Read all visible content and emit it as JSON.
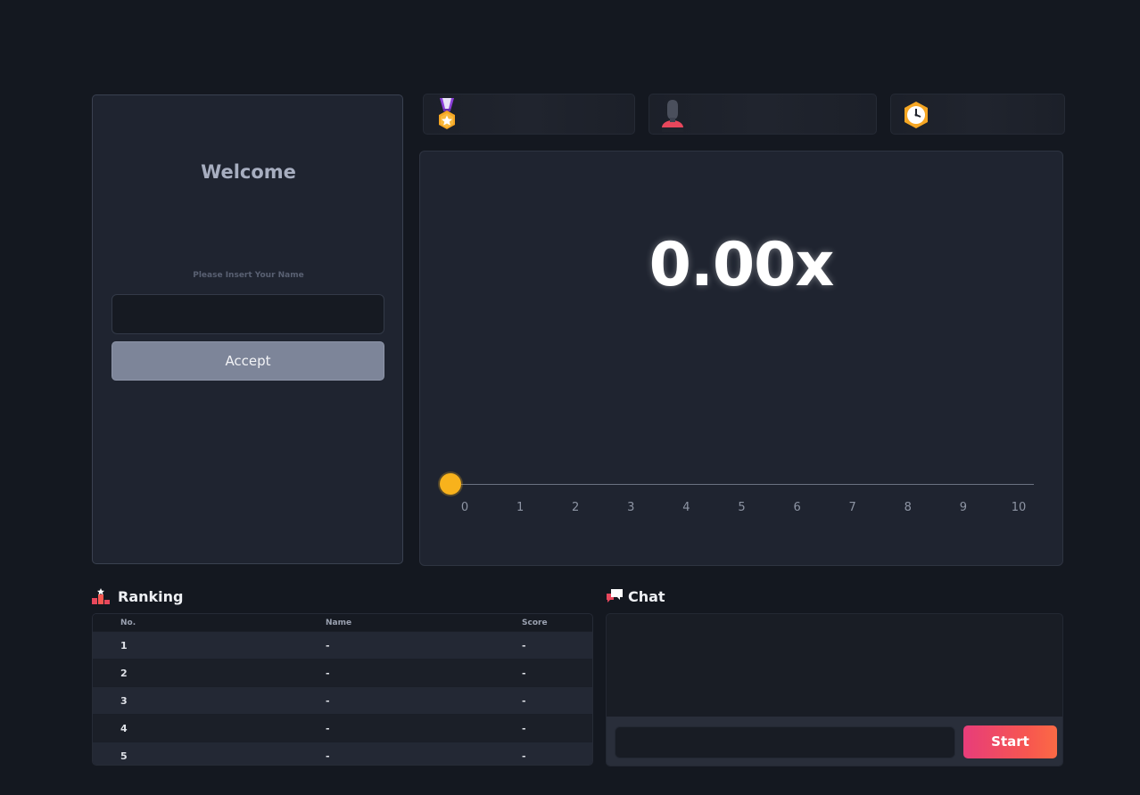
{
  "welcome": {
    "title": "Welcome",
    "name_label": "Please Insert Your Name",
    "name_value": "",
    "accept_label": "Accept"
  },
  "stats": {
    "points_icon": "medal-icon",
    "points_value": "",
    "player_icon": "user-icon",
    "player_value": "",
    "time_icon": "clock-icon",
    "time_value": ""
  },
  "game": {
    "multiplier": "0.00x",
    "ticks": [
      "0",
      "1",
      "2",
      "3",
      "4",
      "5",
      "6",
      "7",
      "8",
      "9",
      "10"
    ],
    "slider_value": 0,
    "handle_color": "#f8b21c"
  },
  "ranking": {
    "title": "Ranking",
    "icon": "podium-icon",
    "columns": [
      "No.",
      "Name",
      "Score"
    ],
    "rows": [
      {
        "no": "1",
        "name": "-",
        "score": "-"
      },
      {
        "no": "2",
        "name": "-",
        "score": "-"
      },
      {
        "no": "3",
        "name": "-",
        "score": "-"
      },
      {
        "no": "4",
        "name": "-",
        "score": "-"
      },
      {
        "no": "5",
        "name": "-",
        "score": "-"
      }
    ]
  },
  "chat": {
    "title": "Chat",
    "icon": "chat-bubbles-icon",
    "input_value": "",
    "start_label": "Start"
  },
  "colors": {
    "background": "#141820",
    "panel": "#1f2430",
    "accent_gradient_start": "#e73d7a",
    "accent_gradient_end": "#fb6a45",
    "accept_button": "#7d8599"
  }
}
